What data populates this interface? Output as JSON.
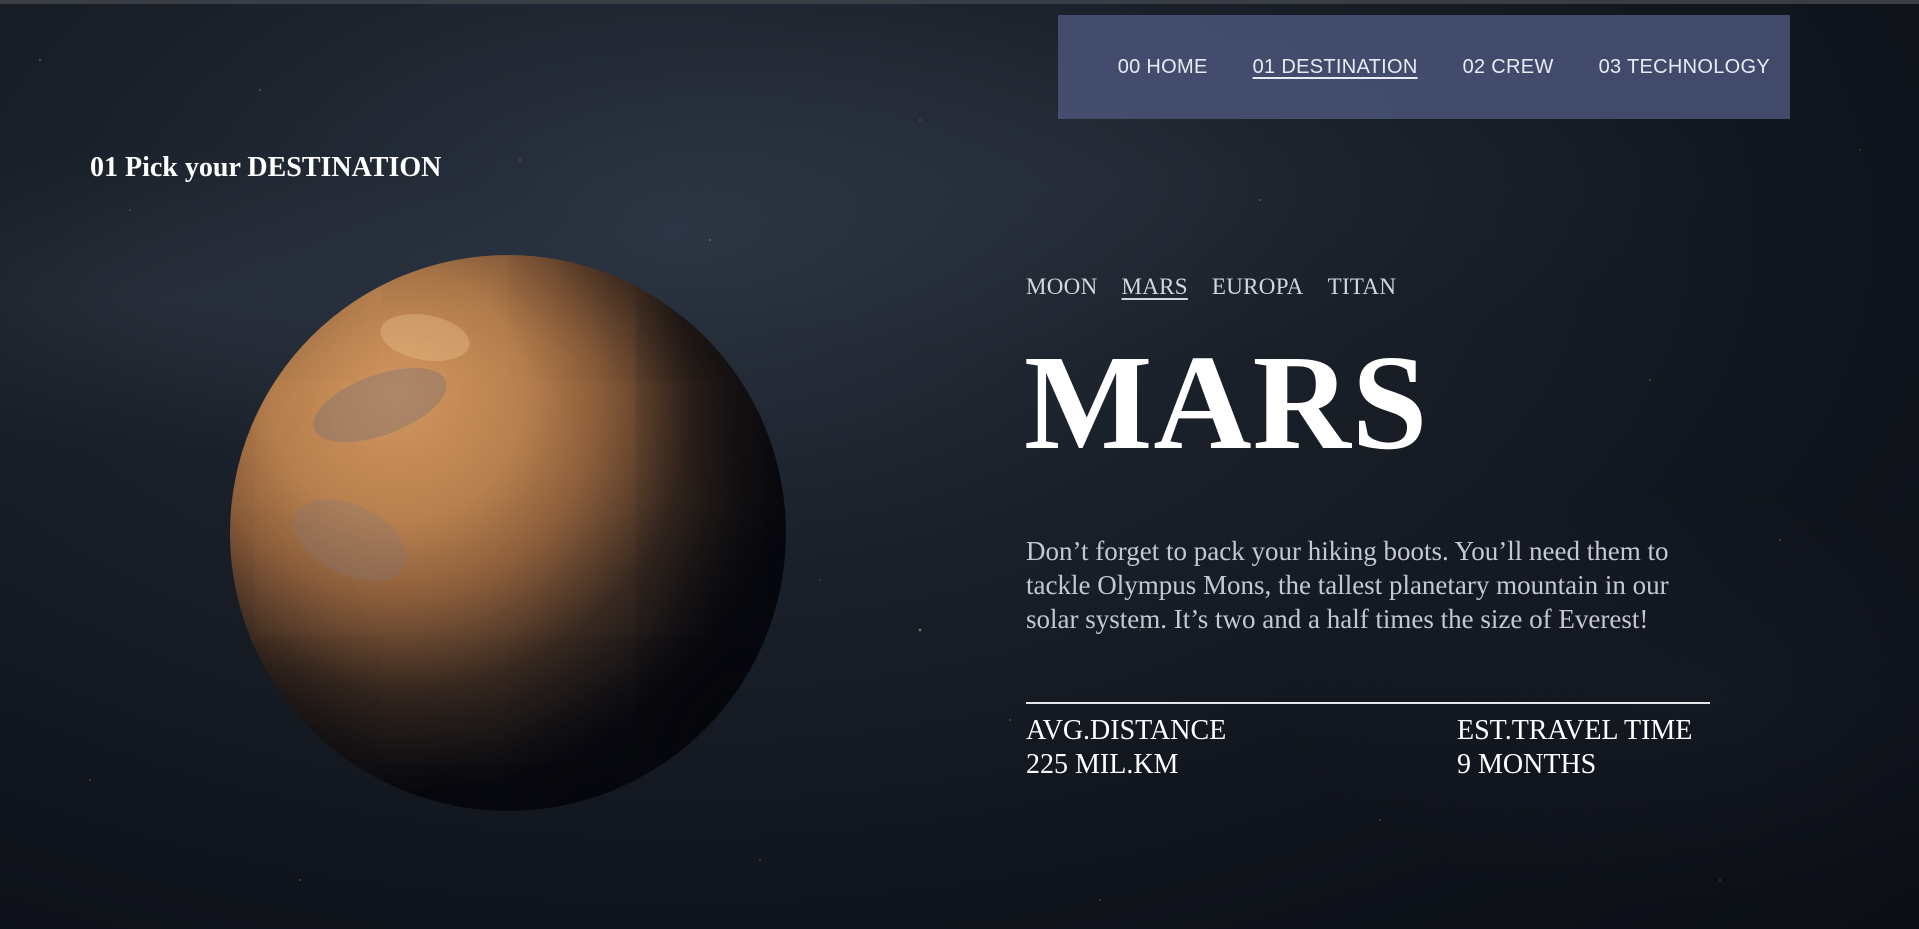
{
  "nav": {
    "items": [
      {
        "label": "00 HOME",
        "active": false
      },
      {
        "label": "01 DESTINATION",
        "active": true
      },
      {
        "label": "02 CREW",
        "active": false
      },
      {
        "label": "03 TECHNOLOGY",
        "active": false
      }
    ],
    "background_color": "#4a5478"
  },
  "page": {
    "heading": "01 Pick your DESTINATION"
  },
  "destinations": {
    "tabs": [
      {
        "label": "MOON",
        "active": false
      },
      {
        "label": "MARS",
        "active": true
      },
      {
        "label": "EUROPA",
        "active": false
      },
      {
        "label": "TITAN",
        "active": false
      }
    ]
  },
  "destination": {
    "name": "MARS",
    "description": "Don’t forget to pack your hiking boots. You’ll need them to tackle Olympus Mons, the tallest planetary mountain in our solar system. It’s two and a half times the size of Everest!",
    "stats": {
      "distance_label": "AVG.DISTANCE",
      "distance_value": "225 MIL.KM",
      "travel_label": "EST.TRAVEL TIME",
      "travel_value": "9 MONTHS"
    }
  },
  "colors": {
    "background": "#10141c",
    "planet": "#b8804e",
    "text": "#ffffff",
    "muted_text": "#c4c8d1"
  }
}
